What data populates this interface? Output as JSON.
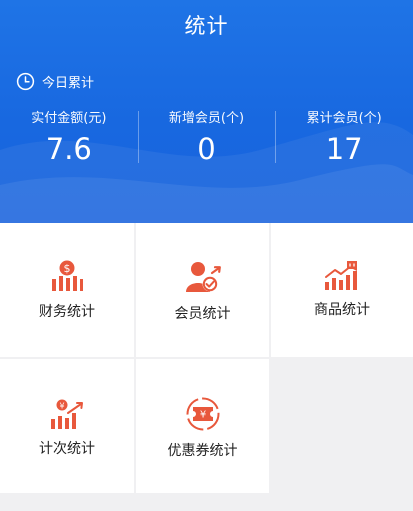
{
  "header": {
    "title": "统计",
    "today_label": "今日累计"
  },
  "stats": [
    {
      "label": "实付金额(元)",
      "value": "7.6"
    },
    {
      "label": "新增会员(个)",
      "value": "0"
    },
    {
      "label": "累计会员(个)",
      "value": "17"
    }
  ],
  "menu": [
    {
      "label": "财务统计",
      "icon": "finance-icon"
    },
    {
      "label": "会员统计",
      "icon": "member-icon"
    },
    {
      "label": "商品统计",
      "icon": "goods-icon"
    },
    {
      "label": "计次统计",
      "icon": "count-icon"
    },
    {
      "label": "优惠券统计",
      "icon": "coupon-icon"
    }
  ],
  "colors": {
    "header_blue": "#1a6ae2",
    "icon_red": "#e8583c",
    "page_bg": "#f0f0f2"
  }
}
